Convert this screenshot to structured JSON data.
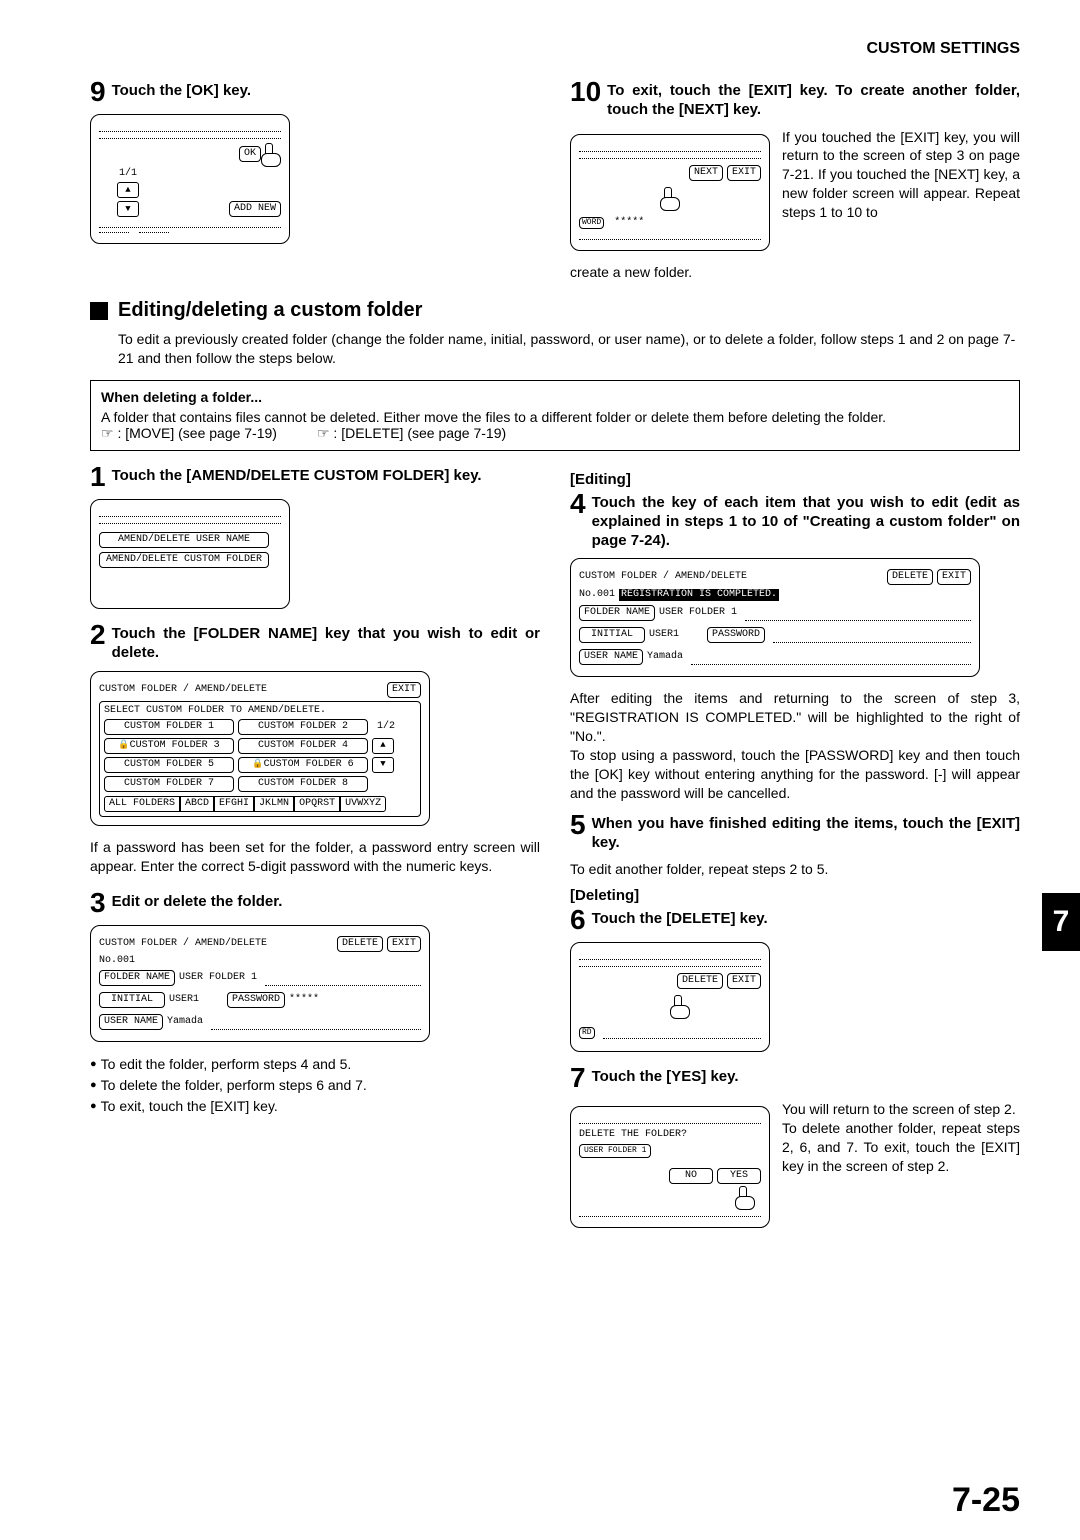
{
  "header": "CUSTOM SETTINGS",
  "step9": {
    "num": "9",
    "text": "Touch the [OK] key.",
    "ok": "OK",
    "pager": "1/1",
    "addnew": "ADD NEW"
  },
  "step10": {
    "num": "10",
    "text": "To exit, touch the [EXIT] key. To create another folder, touch the [NEXT] key.",
    "next": "NEXT",
    "exit": "EXIT",
    "word": "WORD",
    "stars": "*****",
    "body": "If you touched the [EXIT] key, you will return to the screen of step 3 on page 7-21. If you touched the [NEXT] key, a new folder screen will appear. Repeat steps 1 to 10 to",
    "body_tail": "create a new folder."
  },
  "section_title": "Editing/deleting a custom folder",
  "section_body": "To edit a previously created folder (change the folder name, initial, password, or user name), or to delete a folder, follow steps 1 and 2 on page 7-21 and then follow the steps below.",
  "note": {
    "title": "When deleting a folder...",
    "line1": "A folder that contains files cannot be deleted. Either move the files to a different folder or delete them before deleting the folder.",
    "move": "☞ : [MOVE] (see page 7-19)",
    "delete": "☞ : [DELETE] (see page 7-19)"
  },
  "step1": {
    "num": "1",
    "text": "Touch the [AMEND/DELETE CUSTOM FOLDER] key.",
    "btn1": "AMEND/DELETE USER NAME",
    "btn2": "AMEND/DELETE CUSTOM FOLDER"
  },
  "step2": {
    "num": "2",
    "text": "Touch the [FOLDER NAME] key that you wish to edit or delete.",
    "title": "CUSTOM FOLDER / AMEND/DELETE",
    "exit": "EXIT",
    "subtitle": "SELECT CUSTOM FOLDER TO AMEND/DELETE.",
    "folders": [
      "CUSTOM FOLDER 1",
      "CUSTOM FOLDER 2",
      "CUSTOM FOLDER 3",
      "CUSTOM FOLDER 4",
      "CUSTOM FOLDER 5",
      "CUSTOM FOLDER 6",
      "CUSTOM FOLDER 7",
      "CUSTOM FOLDER 8"
    ],
    "pager": "1/2",
    "tabs": [
      "ALL FOLDERS",
      "ABCD",
      "EFGHI",
      "JKLMN",
      "OPQRST",
      "UVWXYZ"
    ],
    "body": "If a password has been set for the folder, a password entry screen will appear. Enter the correct 5-digit password with the numeric keys."
  },
  "step3": {
    "num": "3",
    "text": "Edit or delete the folder.",
    "title": "CUSTOM FOLDER / AMEND/DELETE",
    "delete": "DELETE",
    "exit": "EXIT",
    "no": "No.001",
    "foldername_label": "FOLDER NAME",
    "foldername_val": "USER FOLDER 1",
    "initial_label": "INITIAL",
    "initial_val": "USER1",
    "password_label": "PASSWORD",
    "password_val": "*****",
    "username_label": "USER NAME",
    "username_val": "Yamada",
    "bullets": [
      "To edit the folder, perform steps 4 and 5.",
      "To delete the folder, perform steps 6 and 7.",
      "To exit, touch the [EXIT] key."
    ]
  },
  "editing_head": "[Editing]",
  "step4": {
    "num": "4",
    "text": "Touch the key of each item that you wish to edit (edit as explained in steps 1 to 10 of \"Creating a custom folder\" on page 7-24).",
    "title": "CUSTOM FOLDER / AMEND/DELETE",
    "delete": "DELETE",
    "exit": "EXIT",
    "no": "No.001",
    "reg": "REGISTRATION IS COMPLETED.",
    "foldername_label": "FOLDER NAME",
    "foldername_val": "USER FOLDER 1",
    "initial_label": "INITIAL",
    "initial_val": "USER1",
    "password_label": "PASSWORD",
    "username_label": "USER NAME",
    "username_val": "Yamada",
    "body": "After editing the items and returning to the screen of step 3, \"REGISTRATION IS COMPLETED.\" will be highlighted to the right of \"No.\".\nTo stop using a password, touch the [PASSWORD] key and then touch the [OK] key without entering anything for the password. [-] will appear and the password will be cancelled."
  },
  "step5": {
    "num": "5",
    "text": "When you have finished editing the items, touch the [EXIT] key.",
    "body": "To edit another folder, repeat steps 2 to 5."
  },
  "deleting_head": "[Deleting]",
  "step6": {
    "num": "6",
    "text": "Touch the [DELETE] key.",
    "delete": "DELETE",
    "exit": "EXIT",
    "rd": "RD"
  },
  "step7": {
    "num": "7",
    "text": "Touch the [YES] key.",
    "prompt": "DELETE THE FOLDER?",
    "folder": "USER FOLDER 1",
    "no": "NO",
    "yes": "YES",
    "body": "You will return to the screen of step 2.\nTo delete another folder, repeat steps 2, 6, and 7. To exit, touch the [EXIT] key in the screen of step 2."
  },
  "page_number": "7-25",
  "side_tab": "7"
}
